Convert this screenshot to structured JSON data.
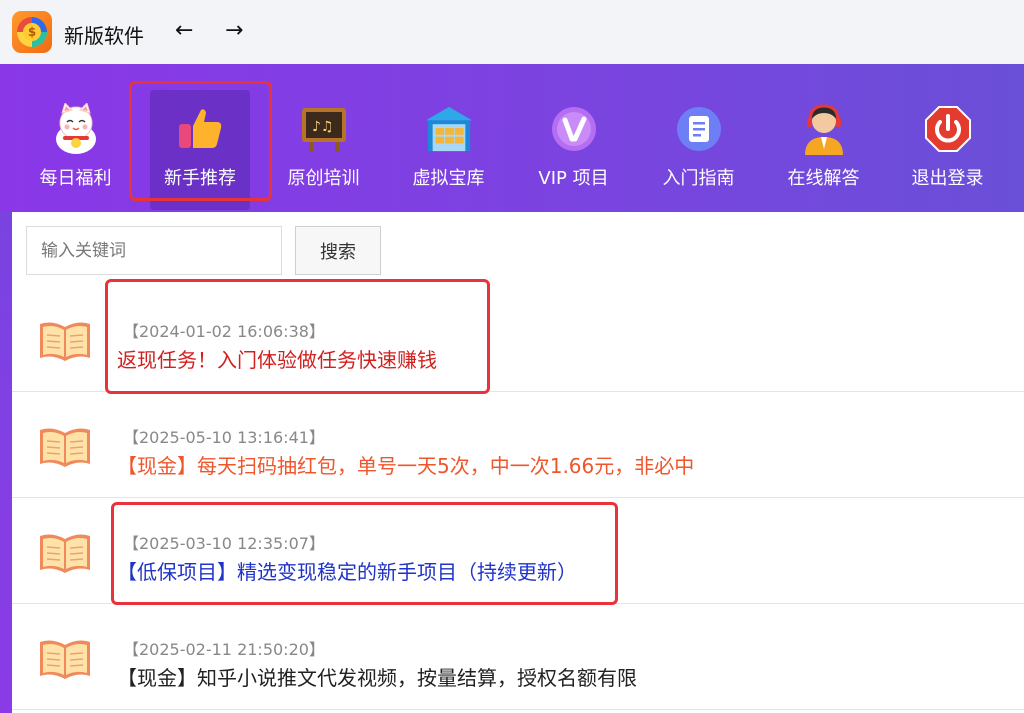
{
  "app": {
    "title": "新版软件",
    "back_symbol": "←",
    "forward_symbol": "→",
    "logo_glyph": "$",
    "logo_icon": "coin-ring-logo-icon"
  },
  "toolbar": {
    "items": [
      {
        "label": "每日福利",
        "icon": "lucky-cat-icon"
      },
      {
        "label": "新手推荐",
        "icon": "thumbs-up-icon"
      },
      {
        "label": "原创培训",
        "icon": "chalkboard-music-icon"
      },
      {
        "label": "虚拟宝库",
        "icon": "warehouse-icon"
      },
      {
        "label": "VIP 项目",
        "icon": "vip-badge-icon"
      },
      {
        "label": "入门指南",
        "icon": "guide-document-icon"
      },
      {
        "label": "在线解答",
        "icon": "support-agent-icon"
      },
      {
        "label": "退出登录",
        "icon": "power-button-icon"
      }
    ],
    "active_index": 1,
    "colors": {
      "gradient_start": "#8a37e8",
      "gradient_end": "#6a4fd8"
    }
  },
  "search": {
    "placeholder": "输入关键词",
    "value": "",
    "button_label": "搜索"
  },
  "articles": [
    {
      "date": "【2024-01-02 16:06:38】",
      "title": "返现任务！入门体验做任务快速赚钱",
      "color": "#d0201f",
      "highlighted": true
    },
    {
      "date": "【2025-05-10 13:16:41】",
      "title": "【现金】每天扫码抽红包，单号一天5次，中一次1.66元，非必中",
      "color": "#f0562b",
      "highlighted": false
    },
    {
      "date": "【2025-03-10 12:35:07】",
      "title": "【低保项目】精选变现稳定的新手项目（持续更新）",
      "color": "#2034c8",
      "highlighted": true
    },
    {
      "date": "【2025-02-11 21:50:20】",
      "title": "【现金】知乎小说推文代发视频，按量结算，授权名额有限",
      "color": "#222222",
      "highlighted": false
    }
  ],
  "highlight_color": "#e8333b"
}
